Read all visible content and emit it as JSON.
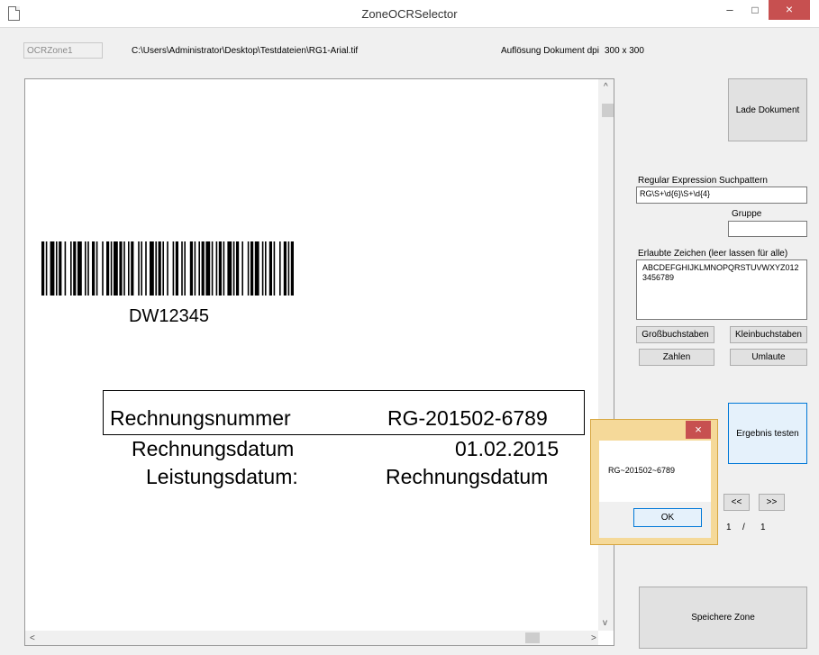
{
  "window": {
    "title": "ZoneOCRSelector",
    "minimize": "–",
    "maximize": "□",
    "close": "×"
  },
  "info": {
    "zone_name": "OCRZone1",
    "file_path": "C:\\Users\\Administrator\\Desktop\\Testdateien\\RG1-Arial.tif",
    "resolution_label": "Auflösung Dokument dpi",
    "resolution_value": "300 x 300"
  },
  "document": {
    "barcode_text": "DW12345",
    "lines": [
      {
        "label": "Rechnungsnummer",
        "value": "RG-201502-6789"
      },
      {
        "label": "Rechnungsdatum",
        "value": "01.02.2015"
      },
      {
        "label": "Leistungsdatum:",
        "value": "Rechnungsdatum"
      }
    ]
  },
  "scroll": {
    "up": "^",
    "down": "v",
    "left": "<",
    "right": ">"
  },
  "panel": {
    "load_button": "Lade Dokument",
    "regex_label": "Regular Expression Suchpattern",
    "regex_value": "RG\\S+\\d{6}\\S+\\d{4}",
    "group_label": "Gruppe",
    "group_value": "",
    "allowed_label": "Erlaubte Zeichen (leer lassen für alle)",
    "allowed_value": "ABCDEFGHIJKLMNOPQRSTUVWXYZ0123456789",
    "upper_button": "Großbuchstaben",
    "lower_button": "Kleinbuchstaben",
    "numbers_button": "Zahlen",
    "umlaut_button": "Umlaute",
    "test_button": "Ergebnis testen",
    "prev_button": "<<",
    "next_button": ">>",
    "page_current": "1",
    "page_sep": "/",
    "page_total": "1",
    "save_button": "Speichere Zone"
  },
  "dialog": {
    "message": "RG~201502~6789",
    "ok": "OK",
    "close": "×"
  }
}
